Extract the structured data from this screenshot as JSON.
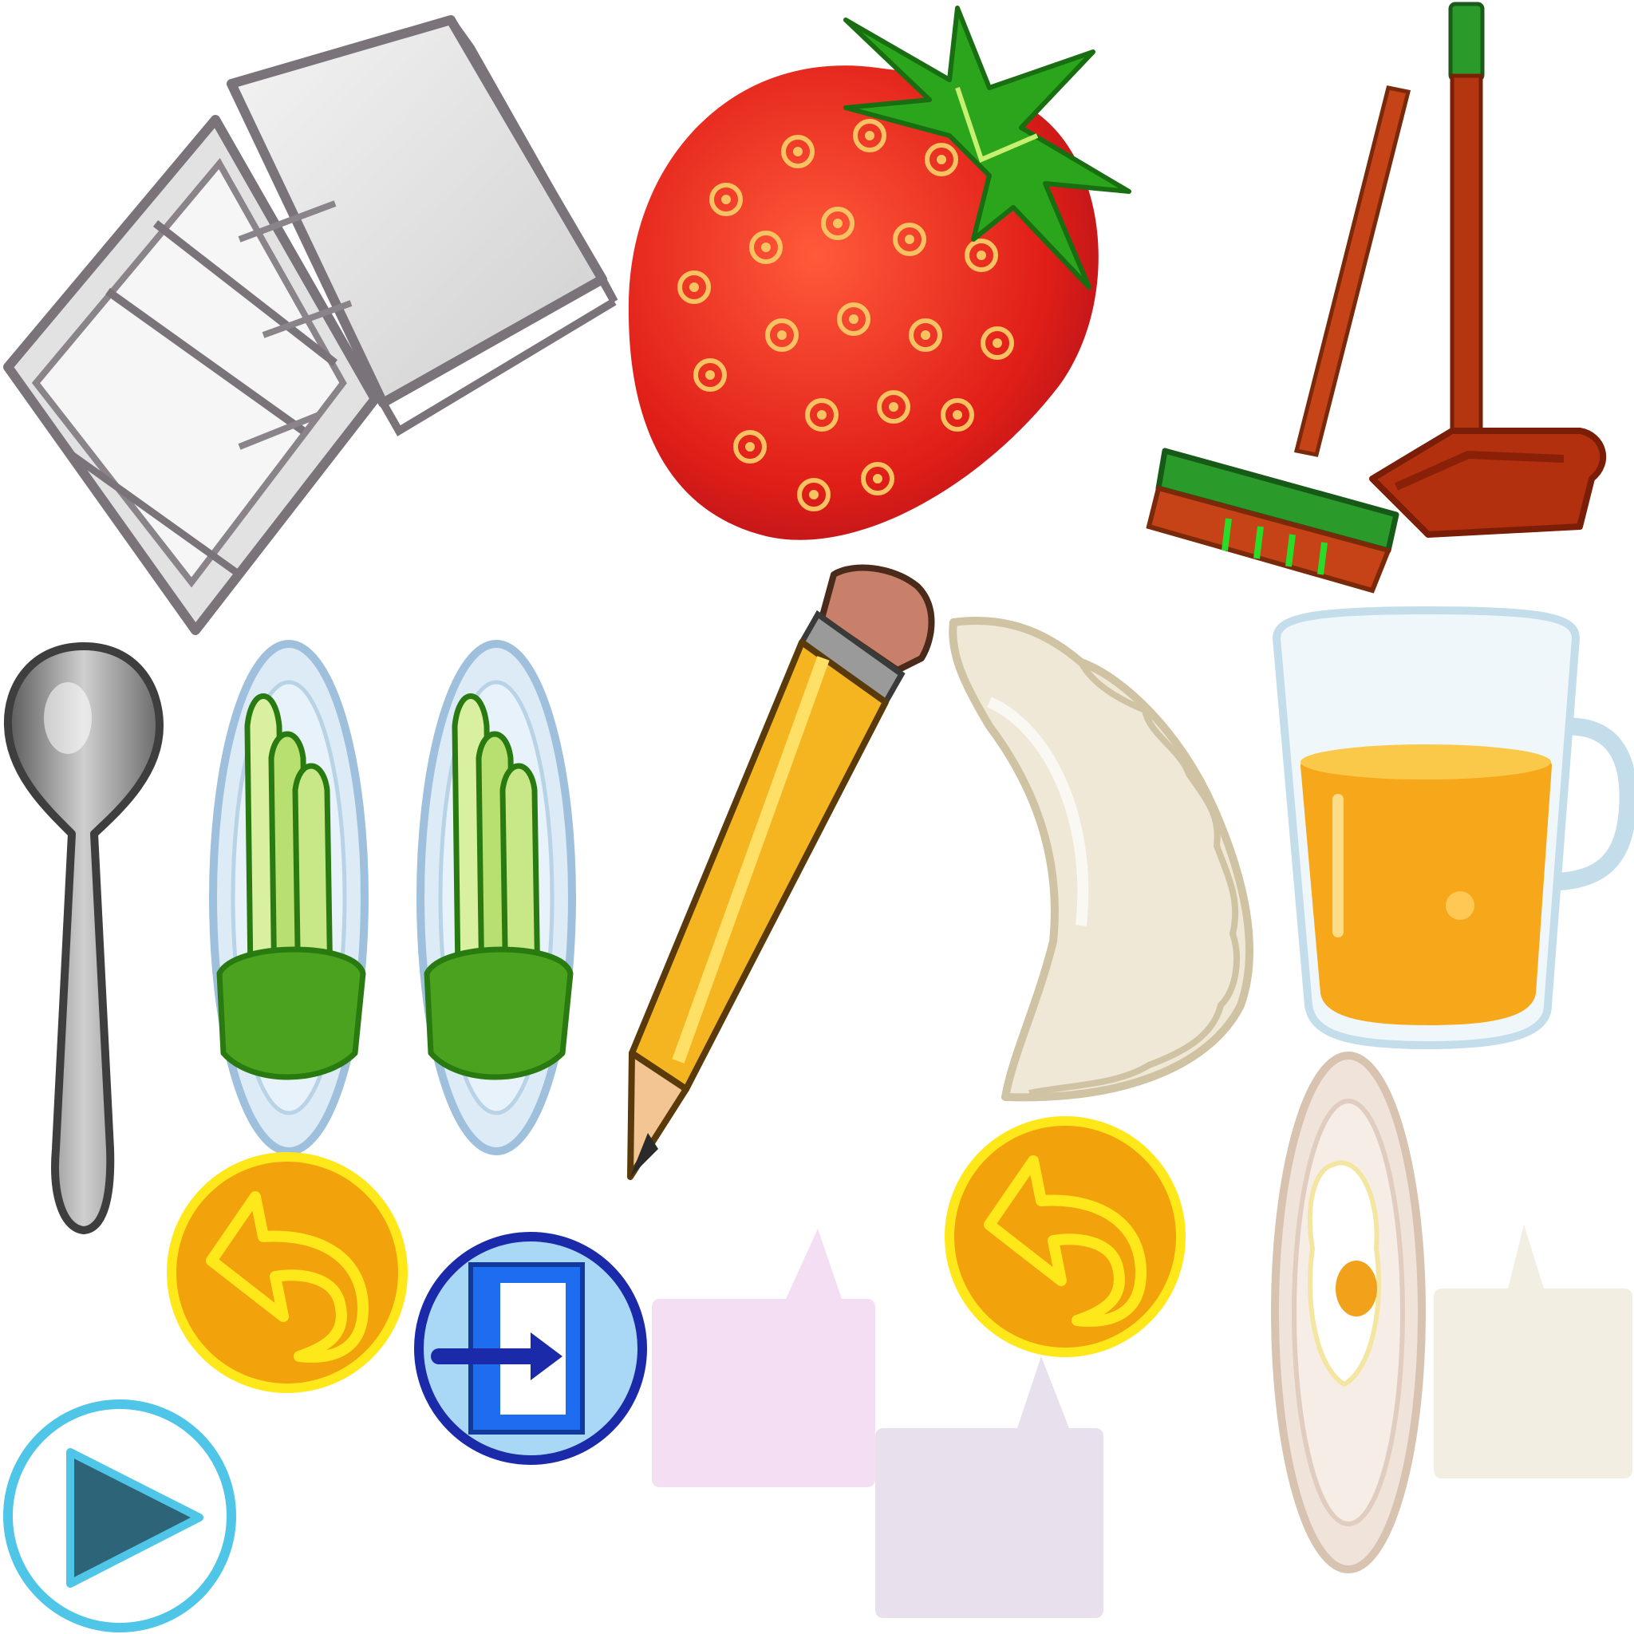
{
  "canvas": {
    "background": "#ffffff"
  },
  "sprites": [
    {
      "name": "fridge",
      "icon": "open-refrigerator-icon",
      "colors": {
        "body": "#e4e4e4",
        "outline": "#7a747a"
      }
    },
    {
      "name": "strawberry",
      "icon": "strawberry-icon",
      "colors": {
        "fruit": "#e8221c",
        "seed": "#f6c262",
        "leaf": "#2aa51c"
      }
    },
    {
      "name": "broom-dustpan",
      "icon": "broom-and-dustpan-icon",
      "colors": {
        "handle": "#c54316",
        "brush": "#2a9a2a",
        "dustpan": "#b3300e"
      }
    },
    {
      "name": "spoon",
      "icon": "spoon-icon",
      "colors": {
        "metal": "#8a8a8a"
      }
    },
    {
      "name": "plate-1",
      "icon": "asparagus-plate-icon",
      "colors": {
        "plate": "#d8e8f4",
        "asparagus": "#5fb82e"
      }
    },
    {
      "name": "plate-2",
      "icon": "asparagus-plate-icon",
      "colors": {
        "plate": "#d8e8f4",
        "asparagus": "#5fb82e"
      }
    },
    {
      "name": "pencil",
      "icon": "pencil-icon",
      "colors": {
        "body": "#f4b521",
        "eraser": "#c8806a",
        "tip": "#f2c593"
      }
    },
    {
      "name": "dumpling",
      "icon": "dumpling-icon",
      "colors": {
        "dough": "#efe8d6",
        "outline": "#cfc3a3"
      }
    },
    {
      "name": "juice-glass",
      "icon": "juice-glass-icon",
      "colors": {
        "juice": "#f7a81a",
        "glass": "#c4ddeb"
      }
    },
    {
      "name": "egg-plate",
      "icon": "fried-egg-plate-icon",
      "colors": {
        "plate": "#f0e4da",
        "yolk": "#f2a11a"
      }
    }
  ],
  "buttons": [
    {
      "name": "undo-button-1",
      "icon": "undo-arrow-icon",
      "colors": {
        "fill": "#f2a20a",
        "ring": "#ffe81a"
      }
    },
    {
      "name": "undo-button-2",
      "icon": "undo-arrow-icon",
      "colors": {
        "fill": "#f2a20a",
        "ring": "#ffe81a"
      }
    },
    {
      "name": "exit-button",
      "icon": "exit-door-icon",
      "colors": {
        "fill": "#a9d8f7",
        "ring": "#1a2aa8",
        "door": "#1e6cf0"
      }
    },
    {
      "name": "play-button",
      "icon": "play-triangle-icon",
      "colors": {
        "fill": "#ffffff",
        "ring": "#4fc6e8",
        "triangle": "#2e6478"
      }
    }
  ],
  "bubbles": [
    {
      "name": "bubble-pink",
      "icon": "speech-bubble-icon",
      "colors": {
        "fill": "#f4def4"
      }
    },
    {
      "name": "bubble-lavender",
      "icon": "speech-bubble-icon",
      "colors": {
        "fill": "#e8e0ec"
      }
    },
    {
      "name": "bubble-cream",
      "icon": "speech-bubble-icon",
      "colors": {
        "fill": "#f3eee2"
      }
    }
  ]
}
